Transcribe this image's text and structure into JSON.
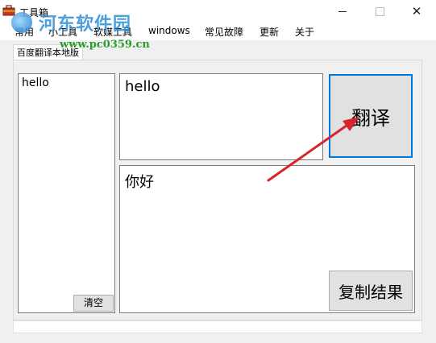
{
  "window": {
    "title": "工具箱"
  },
  "menu": [
    {
      "label": "常用"
    },
    {
      "label": "小工具"
    },
    {
      "label": "软媒工具"
    },
    {
      "label": "windows"
    },
    {
      "label": "常见故障"
    },
    {
      "label": "更新"
    },
    {
      "label": "关于"
    }
  ],
  "tab": {
    "label": "百度翻译本地版"
  },
  "source_list": {
    "text": "hello",
    "clear_label": "清空"
  },
  "input": {
    "text": "hello"
  },
  "translate_button": {
    "label": "翻译"
  },
  "output": {
    "text": "你好"
  },
  "copy_button": {
    "label": "复制结果"
  },
  "watermark": {
    "title": "河东软件园",
    "url": "www.pc0359.cn"
  },
  "colors": {
    "focus_border": "#0078d7",
    "arrow": "#d9232d",
    "watermark_blue": "#2d8fd8",
    "watermark_green": "#2c9a2c"
  }
}
